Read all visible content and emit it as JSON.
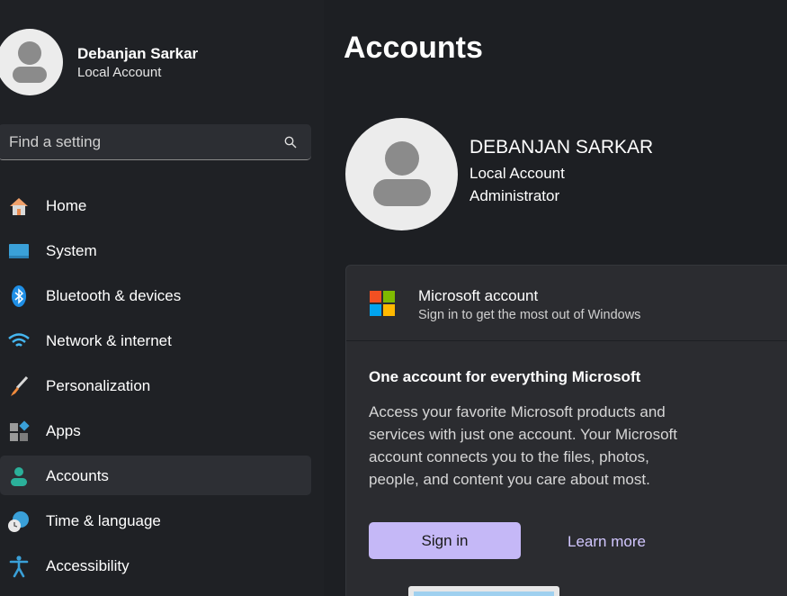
{
  "user": {
    "name": "Debanjan Sarkar",
    "account_type": "Local Account"
  },
  "search": {
    "placeholder": "Find a setting"
  },
  "nav": {
    "items": [
      {
        "label": "Home",
        "icon": "home-icon"
      },
      {
        "label": "System",
        "icon": "system-icon"
      },
      {
        "label": "Bluetooth & devices",
        "icon": "bluetooth-icon"
      },
      {
        "label": "Network & internet",
        "icon": "wifi-icon"
      },
      {
        "label": "Personalization",
        "icon": "brush-icon"
      },
      {
        "label": "Apps",
        "icon": "apps-icon"
      },
      {
        "label": "Accounts",
        "icon": "accounts-icon",
        "active": true
      },
      {
        "label": "Time & language",
        "icon": "time-language-icon"
      },
      {
        "label": "Accessibility",
        "icon": "accessibility-icon"
      }
    ]
  },
  "main": {
    "title": "Accounts",
    "profile": {
      "name": "DEBANJAN SARKAR",
      "account_type": "Local Account",
      "role": "Administrator"
    },
    "ms_card": {
      "title": "Microsoft account",
      "subtitle": "Sign in to get the most out of Windows",
      "promo_title": "One account for everything Microsoft",
      "promo_body": "Access your favorite Microsoft products and services with just one account. Your Microsoft account connects you to the files, photos, people, and content you care about most.",
      "signin_label": "Sign in",
      "learn_more_label": "Learn more"
    }
  },
  "colors": {
    "accent": "#c5b8f7",
    "link": "#d2c7ff",
    "background": "#1e2024",
    "card": "#2b2c30"
  }
}
